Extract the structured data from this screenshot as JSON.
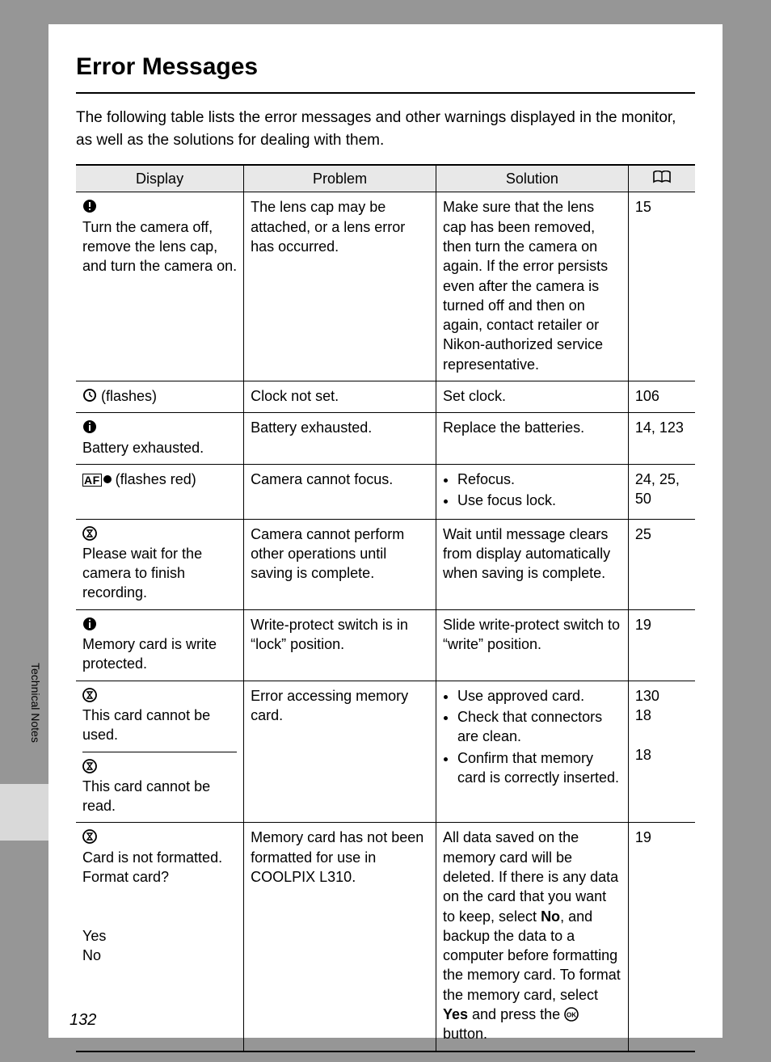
{
  "title": "Error Messages",
  "intro": "The following table lists the error messages and other warnings displayed in the monitor, as well as the solutions for dealing with them.",
  "headers": {
    "display": "Display",
    "problem": "Problem",
    "solution": "Solution"
  },
  "rows": [
    {
      "icon": "warning-exclaim",
      "display": "Turn the camera off, remove the lens cap, and turn the camera on.",
      "problem": "The lens cap may be attached, or a lens error has occurred.",
      "solution_text": "Make sure that the lens cap has been removed, then turn the camera on again. If the error persists even after the camera is turned off and then on again, contact retailer or Nikon-authorized service representative.",
      "ref": "15"
    },
    {
      "icon": "clock",
      "display_suffix": " (flashes)",
      "problem": "Clock not set.",
      "solution_text": "Set clock.",
      "ref": "106"
    },
    {
      "icon": "info-exclaim",
      "display": "Battery exhausted.",
      "problem": "Battery exhausted.",
      "solution_text": "Replace the batteries.",
      "ref": "14, 123"
    },
    {
      "icon": "af-dot",
      "display_suffix": " (flashes red)",
      "problem": "Camera cannot focus.",
      "solution_list": [
        "Refocus.",
        "Use focus lock."
      ],
      "ref": "24, 25, 50"
    },
    {
      "icon": "hourglass",
      "display": "Please wait for the camera to finish recording.",
      "problem": "Camera cannot perform other operations until saving is complete.",
      "solution_text": "Wait until message clears from display automatically when saving is complete.",
      "ref": "25"
    },
    {
      "icon": "info-exclaim",
      "display": "Memory card is write protected.",
      "problem": "Write-protect switch is in “lock” position.",
      "solution_text": "Slide write-protect switch to “write” position.",
      "ref": "19"
    },
    {
      "merged_display": [
        {
          "icon": "hourglass",
          "text": "This card cannot be used."
        },
        {
          "icon": "hourglass",
          "text": "This card cannot be read."
        }
      ],
      "problem": "Error accessing memory card.",
      "solution_list": [
        "Use approved card.",
        "Check that connectors are clean.",
        "Confirm that memory card is correctly inserted."
      ],
      "ref_lines": [
        "130",
        "18",
        "",
        "18"
      ]
    },
    {
      "icon": "hourglass",
      "display_lines": [
        "Card is not formatted. Format card?",
        "",
        "Yes",
        "No"
      ],
      "problem": "Memory card has not been formatted for use in COOLPIX L310.",
      "solution_rich": {
        "pre": "All data saved on the memory card will be deleted. If there is any data on the card that you want to keep, select ",
        "bold1": "No",
        "mid": ", and backup the data to a computer before formatting the memory card. To format the memory card, select ",
        "bold2": "Yes",
        "post1": " and press the ",
        "ok_icon": true,
        "post2": " button."
      },
      "ref": "19"
    }
  ],
  "side_label": "Technical Notes",
  "page_number": "132"
}
